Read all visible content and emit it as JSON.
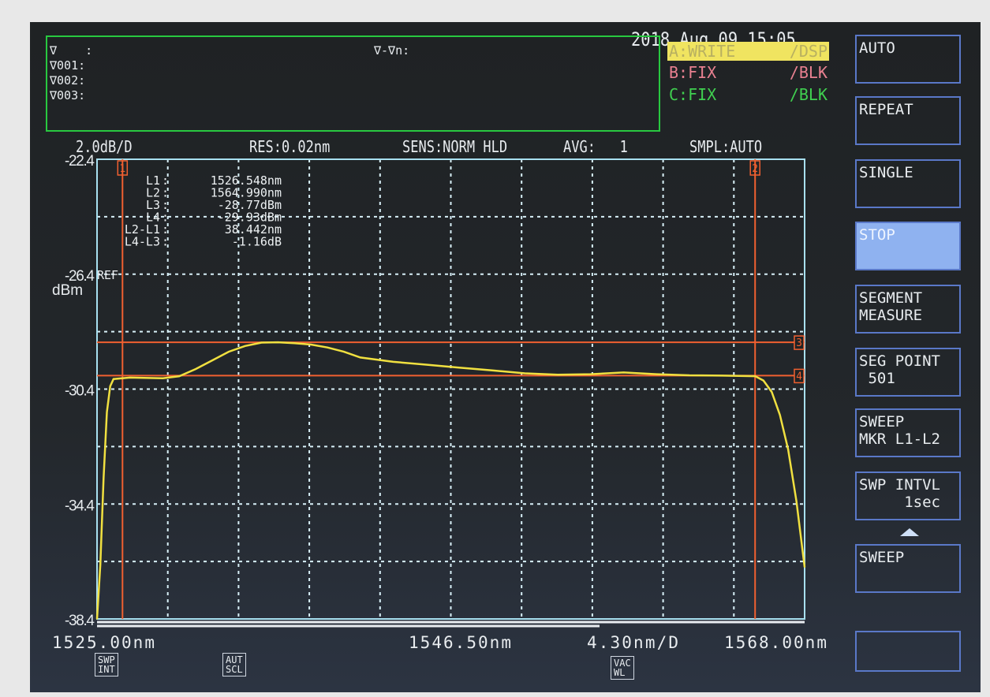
{
  "header": {
    "datetime": "2018 Aug 09 15:05"
  },
  "marker_box": {
    "rows": [
      "∇    :",
      "∇001:",
      "∇002:",
      "∇003:"
    ],
    "delta": "∇-∇n:"
  },
  "traces": [
    {
      "label": "A:WRITE",
      "mode": "/DSP",
      "color": "#e8e060",
      "highlight": true
    },
    {
      "label": "B:FIX",
      "mode": "/BLK",
      "color": "#e07080"
    },
    {
      "label": "C:FIX",
      "mode": "/BLK",
      "color": "#40d050"
    }
  ],
  "status": {
    "scale": "2.0dB/D",
    "res": "RES:0.02nm",
    "sens": "SENS:NORM HLD",
    "avg": "AVG:   1",
    "smpl": "SMPL:AUTO"
  },
  "line_markers": {
    "rows": [
      {
        "name": "L1",
        "value": "1526.548nm"
      },
      {
        "name": "L2",
        "value": "1564.990nm"
      },
      {
        "name": "L3",
        "value": "-28.77dBm"
      },
      {
        "name": "L4",
        "value": "-29.93dBm"
      },
      {
        "name": "L2-L1",
        "value": "38.442nm"
      },
      {
        "name": "L4-L3",
        "value": "-1.16dB"
      }
    ],
    "labels": [
      "1",
      "2",
      "3",
      "4"
    ]
  },
  "softkeys": [
    {
      "label": "AUTO"
    },
    {
      "label": "REPEAT"
    },
    {
      "label": "SINGLE"
    },
    {
      "label": "STOP",
      "selected": true
    },
    {
      "label": "SEGMENT\nMEASURE"
    },
    {
      "label": "SEG POINT\n 501"
    },
    {
      "label": "SWEEP\nMKR L1-L2"
    },
    {
      "label": "SWP INTVL\n     1sec"
    },
    {
      "label": "SWEEP"
    },
    {
      "label": ""
    }
  ],
  "indicators": [
    "SWP\nINT",
    "AUT\nSCL",
    "VAC\nWL"
  ],
  "chart_data": {
    "type": "line",
    "x_unit": "nm",
    "y_unit": "dBm",
    "xlim": [
      1525.0,
      1568.0
    ],
    "ylim": [
      -38.4,
      -22.4
    ],
    "x_tick_labels": [
      "1525.00nm",
      "1546.50nm",
      "1568.00nm"
    ],
    "x_div": "4.30nm/D",
    "y_tick_labels": [
      "-22.4",
      "-26.4",
      "-30.4",
      "-34.4",
      "-38.4"
    ],
    "ref_label": "REF",
    "y_unit_label": "dBm",
    "grid": true,
    "trace_color": "#f0e040",
    "marker_color": "#f06030",
    "markers": {
      "L1": 1526.548,
      "L2": 1564.99,
      "L3": -28.77,
      "L4": -29.93
    },
    "points": [
      [
        1525.0,
        -38.4
      ],
      [
        1525.2,
        -36.5
      ],
      [
        1525.4,
        -33.5
      ],
      [
        1525.6,
        -31.2
      ],
      [
        1525.8,
        -30.3
      ],
      [
        1526.0,
        -30.05
      ],
      [
        1527.0,
        -30.0
      ],
      [
        1529.0,
        -30.02
      ],
      [
        1530.0,
        -29.95
      ],
      [
        1531.0,
        -29.7
      ],
      [
        1532.0,
        -29.4
      ],
      [
        1533.0,
        -29.1
      ],
      [
        1534.0,
        -28.9
      ],
      [
        1535.0,
        -28.78
      ],
      [
        1536.0,
        -28.77
      ],
      [
        1537.0,
        -28.8
      ],
      [
        1538.0,
        -28.85
      ],
      [
        1539.0,
        -28.95
      ],
      [
        1540.0,
        -29.1
      ],
      [
        1541.0,
        -29.3
      ],
      [
        1543.0,
        -29.45
      ],
      [
        1545.0,
        -29.55
      ],
      [
        1547.0,
        -29.65
      ],
      [
        1549.0,
        -29.75
      ],
      [
        1551.0,
        -29.85
      ],
      [
        1553.0,
        -29.9
      ],
      [
        1555.0,
        -29.88
      ],
      [
        1557.0,
        -29.82
      ],
      [
        1559.0,
        -29.88
      ],
      [
        1561.0,
        -29.92
      ],
      [
        1563.0,
        -29.93
      ],
      [
        1565.0,
        -29.95
      ],
      [
        1565.5,
        -30.1
      ],
      [
        1566.0,
        -30.5
      ],
      [
        1566.5,
        -31.3
      ],
      [
        1567.0,
        -32.5
      ],
      [
        1567.5,
        -34.3
      ],
      [
        1568.0,
        -36.6
      ]
    ]
  }
}
